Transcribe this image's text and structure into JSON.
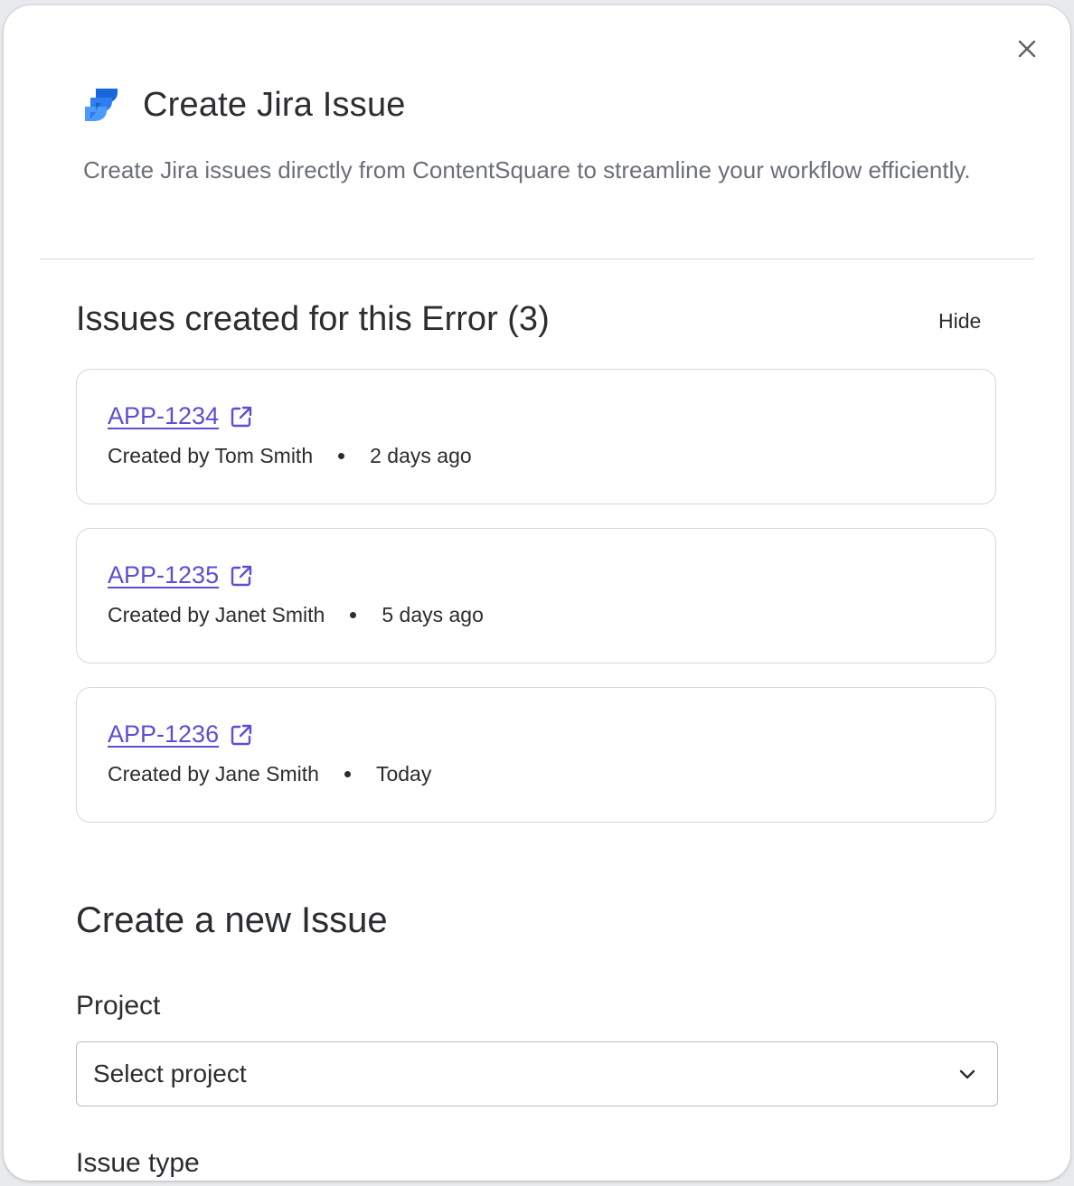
{
  "header": {
    "title": "Create Jira Issue",
    "subtitle": "Create Jira issues directly from ContentSquare to streamline your workflow efficiently."
  },
  "existing_issues": {
    "title": "Issues created for this Error (3)",
    "toggle_label": "Hide",
    "items": [
      {
        "key": "APP-1234",
        "created_by": "Created by Tom Smith",
        "when": "2 days ago"
      },
      {
        "key": "APP-1235",
        "created_by": "Created by Janet Smith",
        "when": "5 days ago"
      },
      {
        "key": "APP-1236",
        "created_by": "Created by Jane Smith",
        "when": "Today"
      }
    ]
  },
  "new_issue": {
    "title": "Create a new Issue",
    "project_label": "Project",
    "project_value": "Select project",
    "issue_type_label": "Issue type"
  },
  "colors": {
    "link": "#5a4fd6",
    "jira_blue_dark": "#1868db",
    "jira_blue_light": "#4c9aff"
  },
  "icons": {
    "close": "close-icon",
    "logo": "jira-logo-icon",
    "external": "external-link-icon",
    "chevron": "chevron-down-icon"
  }
}
